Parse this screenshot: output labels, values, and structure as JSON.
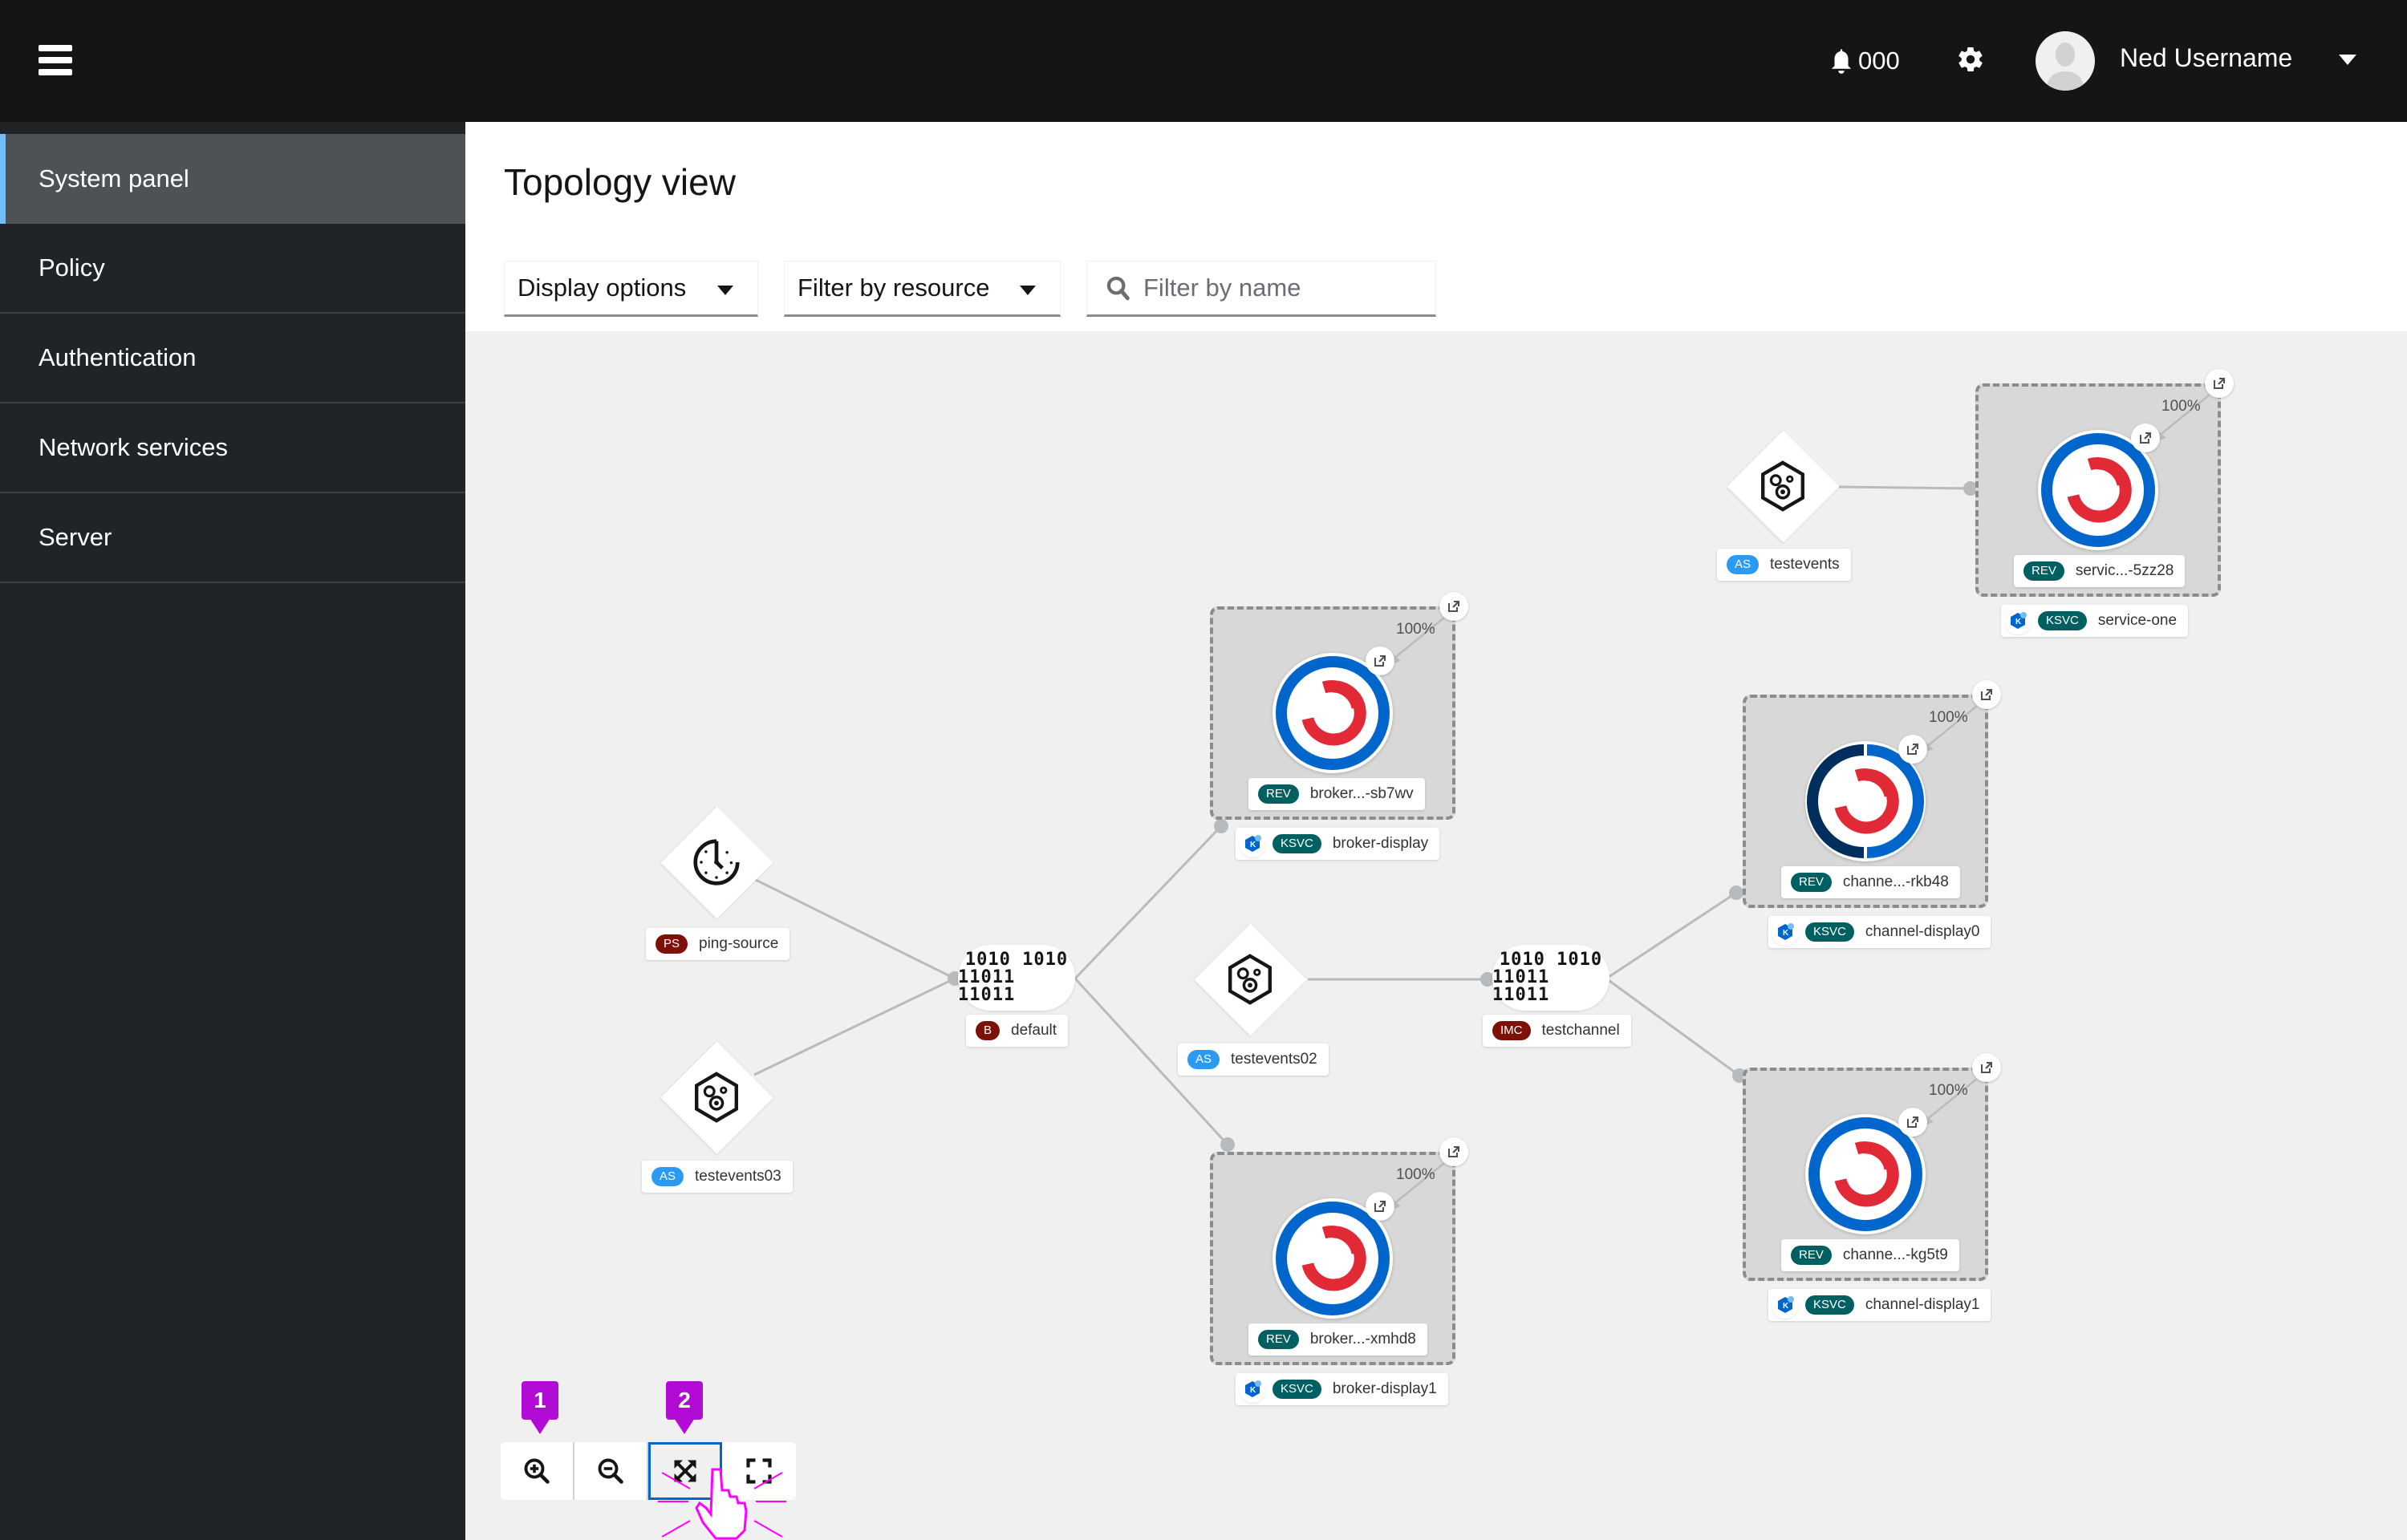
{
  "masthead": {
    "notifications_count": "000",
    "username": "Ned Username",
    "icons": {
      "menu": "hamburger-icon",
      "notifications": "bell-icon",
      "settings": "gear-icon",
      "avatar": "user-avatar",
      "user_menu": "caret-down-icon"
    }
  },
  "sidebar": {
    "items": [
      {
        "label": "System panel",
        "active": true
      },
      {
        "label": "Policy",
        "active": false
      },
      {
        "label": "Authentication",
        "active": false
      },
      {
        "label": "Network services",
        "active": false
      },
      {
        "label": "Server",
        "active": false
      }
    ]
  },
  "page": {
    "title": "Topology view",
    "toolbar": {
      "display_options_label": "Display options",
      "filter_resource_label": "Filter by resource",
      "filter_name_placeholder": "Filter by name",
      "filter_name_value": ""
    }
  },
  "topology": {
    "sources": [
      {
        "id": "ping-source",
        "badge": "PS",
        "name": "ping-source",
        "icon": "clock-icon"
      },
      {
        "id": "testevents03",
        "badge": "AS",
        "name": "testevents03",
        "icon": "gears-hexagon-icon"
      },
      {
        "id": "testevents02",
        "badge": "AS",
        "name": "testevents02",
        "icon": "gears-hexagon-icon"
      },
      {
        "id": "testevents",
        "badge": "AS",
        "name": "testevents",
        "icon": "gears-hexagon-icon"
      }
    ],
    "brokers": [
      {
        "id": "default",
        "badge": "B",
        "name": "default",
        "glyph_line1": "1010 1010",
        "glyph_line2": "11011 11011"
      },
      {
        "id": "testchannel",
        "badge": "IMC",
        "name": "testchannel",
        "glyph_line1": "1010 1010",
        "glyph_line2": "11011 11011"
      }
    ],
    "services": [
      {
        "id": "broker-display",
        "rev_badge": "REV",
        "revision": "broker...-sb7wv",
        "ksvc_badge": "KSVC",
        "service": "broker-display",
        "traffic": "100%"
      },
      {
        "id": "broker-display1",
        "rev_badge": "REV",
        "revision": "broker...-xmhd8",
        "ksvc_badge": "KSVC",
        "service": "broker-display1",
        "traffic": "100%"
      },
      {
        "id": "channel-display0",
        "rev_badge": "REV",
        "revision": "channe...-rkb48",
        "ksvc_badge": "KSVC",
        "service": "channel-display0",
        "traffic": "100%"
      },
      {
        "id": "channel-display1",
        "rev_badge": "REV",
        "revision": "channe...-kg5t9",
        "ksvc_badge": "KSVC",
        "service": "channel-display1",
        "traffic": "100%"
      },
      {
        "id": "service-one",
        "rev_badge": "REV",
        "revision": "servic...-5zz28",
        "ksvc_badge": "KSVC",
        "service": "service-one",
        "traffic": "100%"
      }
    ],
    "edges": [
      {
        "from": "ping-source",
        "to": "default"
      },
      {
        "from": "testevents03",
        "to": "default"
      },
      {
        "from": "default",
        "to": "broker-display"
      },
      {
        "from": "default",
        "to": "broker-display1"
      },
      {
        "from": "testevents02",
        "to": "testchannel"
      },
      {
        "from": "testchannel",
        "to": "channel-display0"
      },
      {
        "from": "testchannel",
        "to": "channel-display1"
      },
      {
        "from": "testevents",
        "to": "service-one"
      }
    ]
  },
  "zoom_controls": {
    "buttons": [
      {
        "name": "zoom-in",
        "icon": "zoom-in-icon"
      },
      {
        "name": "zoom-out",
        "icon": "zoom-out-icon"
      },
      {
        "name": "fit-to-screen",
        "icon": "expand-arrows-icon",
        "focused": true
      },
      {
        "name": "reset-view",
        "icon": "fullscreen-corners-icon"
      }
    ]
  },
  "annotations": {
    "callout_1": "1",
    "callout_2": "2"
  },
  "colors": {
    "masthead_bg": "#151515",
    "sidebar_bg": "#212427",
    "sidebar_active_bg": "#4f5255",
    "sidebar_active_accent": "#73bcf7",
    "badge_dark_red": "#7d1007",
    "badge_blue": "#2b9af3",
    "badge_teal": "#005f60",
    "pod_ring_blue": "#0066cc",
    "pod_ring_dark": "#002f5d",
    "openshift_red": "#e12a35",
    "callout_purple": "#b30bd6",
    "focus_outline": "#0066cc"
  }
}
